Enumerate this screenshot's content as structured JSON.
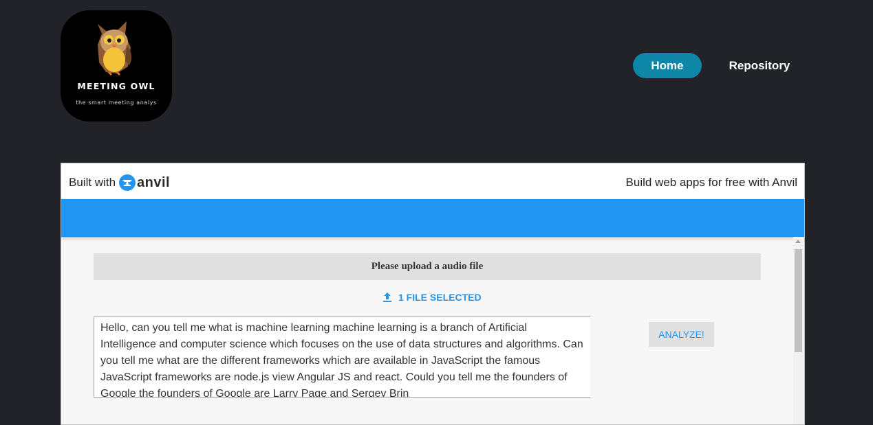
{
  "logo": {
    "title": "MEETING OWL",
    "tagline": "the smart meeting analys"
  },
  "nav": {
    "home": "Home",
    "repository": "Repository"
  },
  "anvil": {
    "built_with": "Built with",
    "brand": "anvil",
    "promo": "Build web apps for free with Anvil"
  },
  "upload": {
    "heading": "Please upload a audio file",
    "file_status": "1 FILE SELECTED",
    "analyze_label": "ANALYZE!"
  },
  "transcript": {
    "text": "Hello, can you tell me what is machine learning machine learning is a branch of Artificial Intelligence and computer science which focuses on the use of data structures and algorithms. Can you tell me what are the different frameworks which are available in JavaScript the famous JavaScript frameworks are node.js view Angular JS and react. Could you tell me the founders of Google the founders of Google are Larry Page and Sergey Brin"
  },
  "colors": {
    "page_bg": "#222328",
    "nav_active": "#0e86a8",
    "accent_blue": "#2196f3"
  }
}
